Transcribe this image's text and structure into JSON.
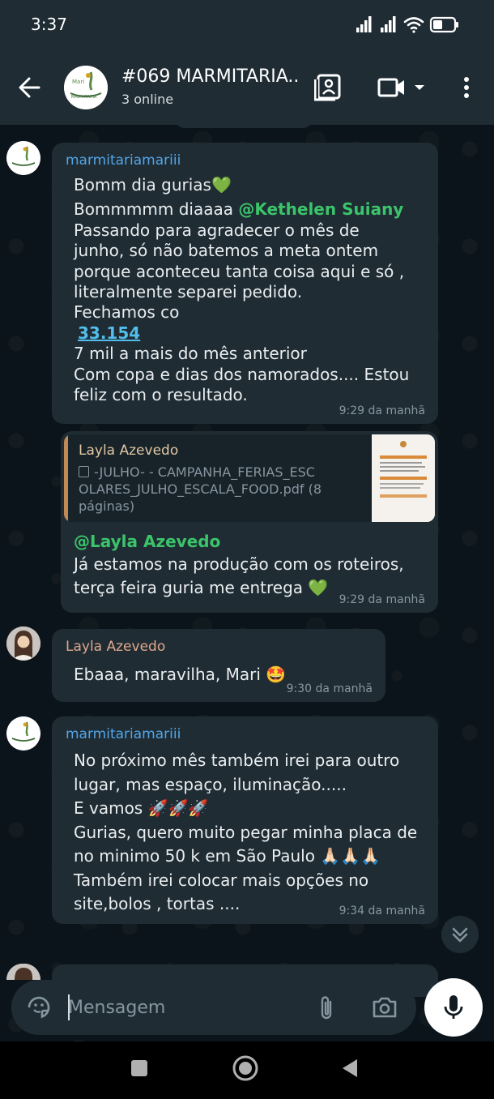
{
  "status_bar": {
    "time": "3:37",
    "icons": [
      "signal-icon",
      "signal-icon",
      "wifi-icon",
      "battery-icon"
    ]
  },
  "header": {
    "title": "#069 MARMITARIA...",
    "subtitle": "3 online",
    "icons": [
      "back-arrow-icon",
      "group-avatar-logo",
      "clipboard-icon",
      "video-call-icon",
      "chevron-down-icon",
      "more-vert-icon"
    ]
  },
  "colors": {
    "app_bar": "#1f2c34",
    "chat_bg": "#0b141a",
    "bubble": "#1f2c34",
    "sender_blue": "#53a6e8",
    "sender_orange": "#e0a88e",
    "mention_green": "#3bc46a",
    "link_blue": "#53bdeb",
    "time_gray": "#8696a0"
  },
  "messages": {
    "m1": {
      "sender": "marmitariamariii",
      "lines": [
        "Bomm dia gurias💚",
        "Bommmmm diaaaa",
        "Passando para agradecer o mês de",
        "junho, só não batemos a meta ontem",
        "porque aconteceu tanta coisa aqui e só ,",
        "literalmente separei pedido.",
        "Fechamos co",
        "33.154",
        "7 mil a mais do mês anterior",
        "Com copa e dias dos namorados.... Estou",
        "feliz com o resultado."
      ],
      "mention": "@Kethelen Suiany",
      "time": "9:29 da manhã"
    },
    "m2": {
      "reply_to_name": "Layla Azevedo",
      "reply_doc_line1": "-JULHO- - CAMPANHA_FERIAS_ESC",
      "reply_doc_line2": "OLARES_JULHO_ESCALA_FOOD.pdf (8",
      "reply_doc_line3": "páginas)",
      "mention": "@Layla Azevedo",
      "line1": "Já estamos na produção com os roteiros,",
      "line2": "terça feira guria me entrega 💚",
      "time": "9:29 da manhã"
    },
    "m3": {
      "sender": "Layla Azevedo",
      "text": "Ebaaa, maravilha, Mari 🤩",
      "time": "9:30 da manhã"
    },
    "m4": {
      "sender": "marmitariamariii",
      "lines": [
        "No próximo mês também irei para outro",
        "lugar, mas espaço, iluminação.....",
        "E vamos 🚀🚀🚀",
        "Gurias, quero muito pegar minha placa de",
        "no minimo 50 k em São Paulo 🙏🏻🙏🏻🙏🏻",
        "Também irei colocar mais opções no",
        "site,bolos , tortas ...."
      ],
      "time": "9:34 da manhã",
      "reaction": "❤️"
    }
  },
  "composer": {
    "placeholder": "Mensagem",
    "icons": [
      "sticker-icon",
      "attach-icon",
      "camera-icon",
      "mic-icon"
    ]
  },
  "nav_bar": {
    "icons": [
      "recents-square-icon",
      "home-circle-icon",
      "back-triangle-icon"
    ]
  }
}
